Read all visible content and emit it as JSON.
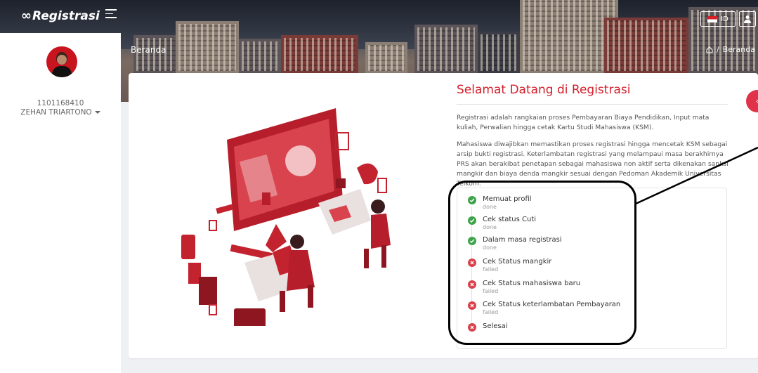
{
  "app": {
    "title": "Registrasi"
  },
  "header": {
    "language": "ID"
  },
  "page": {
    "title": "Beranda",
    "breadcrumb": [
      "Beranda"
    ]
  },
  "user": {
    "nim": "1101168410",
    "name": "ZEHAN TRIARTONO"
  },
  "main": {
    "title": "Selamat Datang di Registrasi",
    "paragraph1": "Registrasi adalah rangkaian proses Pembayaran Biaya Pendidikan, Input mata kuliah, Perwalian hingga cetak Kartu Studi Mahasiswa (KSM).",
    "paragraph2": "Mahasiswa diwajibkan memastikan proses registrasi hingga mencetak KSM sebagai arsip bukti registrasi. Keterlambatan registrasi yang melampaui masa berakhirnya PRS akan berakibat penetapan sebagai mahasiswa non aktif serta dikenakan sanksi mangkir dan biaya denda mangkir sesuai dengan Pedoman Akademik Universitas Telkom."
  },
  "steps": [
    {
      "label": "Memuat profil",
      "status": "done",
      "state": "ok"
    },
    {
      "label": "Cek status Cuti",
      "status": "done",
      "state": "ok"
    },
    {
      "label": "Dalam masa registrasi",
      "status": "done",
      "state": "ok"
    },
    {
      "label": "Cek Status mangkir",
      "status": "failed",
      "state": "fail"
    },
    {
      "label": "Cek Status mahasiswa baru",
      "status": "failed",
      "state": "fail"
    },
    {
      "label": "Cek Status keterlambatan Pembayaran",
      "status": "failed",
      "state": "fail"
    },
    {
      "label": "Selesai",
      "status": "",
      "state": "fail"
    }
  ],
  "colors": {
    "accent": "#d4202c",
    "success": "#3ea34a",
    "danger": "#d8414c"
  },
  "icons": {
    "menu": "hamburger-icon",
    "user": "user-icon",
    "home": "home-icon",
    "ok": "check-circle-icon",
    "fail": "x-circle-icon"
  }
}
